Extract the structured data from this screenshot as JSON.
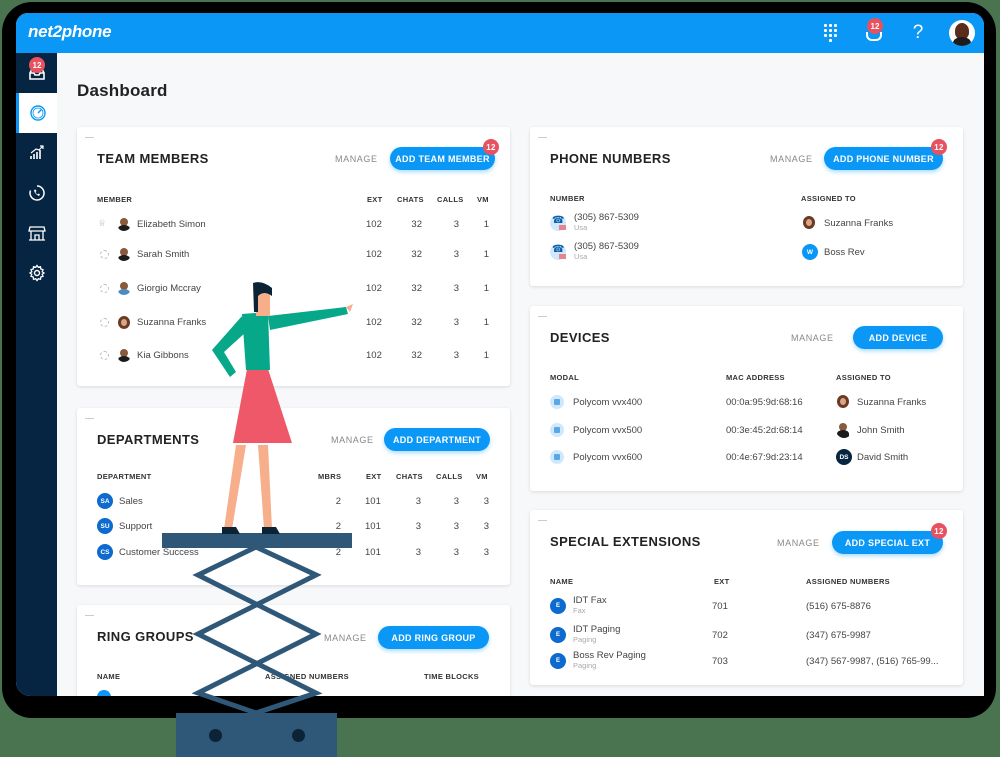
{
  "app": {
    "logo": "net2phone",
    "page_title": "Dashboard"
  },
  "topbar": {
    "icons": [
      "dialpad-icon",
      "notifications-icon",
      "help-icon",
      "user-avatar"
    ],
    "notification_count": "12",
    "help_label": "?"
  },
  "sidebar": {
    "inbox_badge": "12",
    "items": [
      {
        "name": "inbox",
        "icon": "inbox-icon"
      },
      {
        "name": "dashboard",
        "icon": "gauge-icon",
        "active": true
      },
      {
        "name": "analytics",
        "icon": "chart-icon"
      },
      {
        "name": "calls",
        "icon": "phone-history-icon"
      },
      {
        "name": "store",
        "icon": "store-icon"
      },
      {
        "name": "settings",
        "icon": "gear-icon"
      }
    ]
  },
  "team_members": {
    "title": "TEAM MEMBERS",
    "manage": "MANAGE",
    "add_button": "ADD TEAM MEMBER",
    "badge": "12",
    "columns": [
      "MEMBER",
      "EXT",
      "CHATS",
      "CALLS",
      "VM"
    ],
    "rows": [
      {
        "name": "Elizabeth Simon",
        "ext": "102",
        "chats": "32",
        "calls": "3",
        "vm": "1",
        "status": "crown"
      },
      {
        "name": "Sarah Smith",
        "ext": "102",
        "chats": "32",
        "calls": "3",
        "vm": "1",
        "status": "status"
      },
      {
        "name": "Giorgio Mccray",
        "ext": "102",
        "chats": "32",
        "calls": "3",
        "vm": "1",
        "status": "status"
      },
      {
        "name": "Suzanna Franks",
        "ext": "102",
        "chats": "32",
        "calls": "3",
        "vm": "1",
        "status": "status"
      },
      {
        "name": "Kia Gibbons",
        "ext": "102",
        "chats": "32",
        "calls": "3",
        "vm": "1",
        "status": "status"
      }
    ]
  },
  "departments": {
    "title": "DEPARTMENTS",
    "manage": "MANAGE",
    "add_button": "ADD DEPARTMENT",
    "columns": [
      "DEPARTMENT",
      "MBRS",
      "EXT",
      "CHATS",
      "CALLS",
      "VM"
    ],
    "rows": [
      {
        "initials": "SA",
        "name": "Sales",
        "mbrs": "2",
        "ext": "101",
        "chats": "3",
        "calls": "3",
        "vm": "3"
      },
      {
        "initials": "SU",
        "name": "Support",
        "mbrs": "2",
        "ext": "101",
        "chats": "3",
        "calls": "3",
        "vm": "3"
      },
      {
        "initials": "CS",
        "name": "Customer Success",
        "mbrs": "2",
        "ext": "101",
        "chats": "3",
        "calls": "3",
        "vm": "3"
      }
    ]
  },
  "ring_groups": {
    "title": "RING GROUPS",
    "manage": "MANAGE",
    "add_button": "ADD RING GROUP",
    "columns": [
      "NAME",
      "ASSIGNED NUMBERS",
      "TIME BLOCKS"
    ]
  },
  "phone_numbers": {
    "title": "PHONE NUMBERS",
    "manage": "MANAGE",
    "add_button": "ADD PHONE NUMBER",
    "badge": "12",
    "columns": [
      "NUMBER",
      "ASSIGNED TO"
    ],
    "rows": [
      {
        "number": "(305) 867-5309",
        "country": "Usa",
        "assigned": "Suzanna Franks",
        "initials": ""
      },
      {
        "number": "(305) 867-5309",
        "country": "Usa",
        "assigned": "Boss Rev",
        "initials": "W"
      }
    ]
  },
  "devices": {
    "title": "DEVICES",
    "manage": "MANAGE",
    "add_button": "ADD DEVICE",
    "columns": [
      "MODAL",
      "MAC ADDRESS",
      "ASSIGNED TO"
    ],
    "rows": [
      {
        "model": "Polycom vvx400",
        "mac": "00:0a:95:9d:68:16",
        "assigned": "Suzanna Franks",
        "initials": ""
      },
      {
        "model": "Polycom vvx500",
        "mac": "00:3e:45:2d:68:14",
        "assigned": "John Smith",
        "initials": ""
      },
      {
        "model": "Polycom vvx600",
        "mac": "00:4e:67:9d:23:14",
        "assigned": "David Smith",
        "initials": "DS"
      }
    ]
  },
  "special_extensions": {
    "title": "SPECIAL EXTENSIONS",
    "manage": "MANAGE",
    "add_button": "ADD SPECIAL EXT",
    "badge": "12",
    "columns": [
      "NAME",
      "EXT",
      "ASSIGNED NUMBERS"
    ],
    "rows": [
      {
        "name": "IDT Fax",
        "type": "Fax",
        "ext": "701",
        "numbers": "(516) 675-8876"
      },
      {
        "name": "IDT Paging",
        "type": "Paging",
        "ext": "702",
        "numbers": "(347) 675-9987"
      },
      {
        "name": "Boss Rev Paging",
        "type": "Paging",
        "ext": "703",
        "numbers": "(347) 567-9987, (516) 765-99..."
      }
    ]
  },
  "colors": {
    "brand_blue": "#0a97f5",
    "sidebar_navy": "#062542",
    "badge_red": "#e8515f",
    "background_green": "#4a7450"
  }
}
